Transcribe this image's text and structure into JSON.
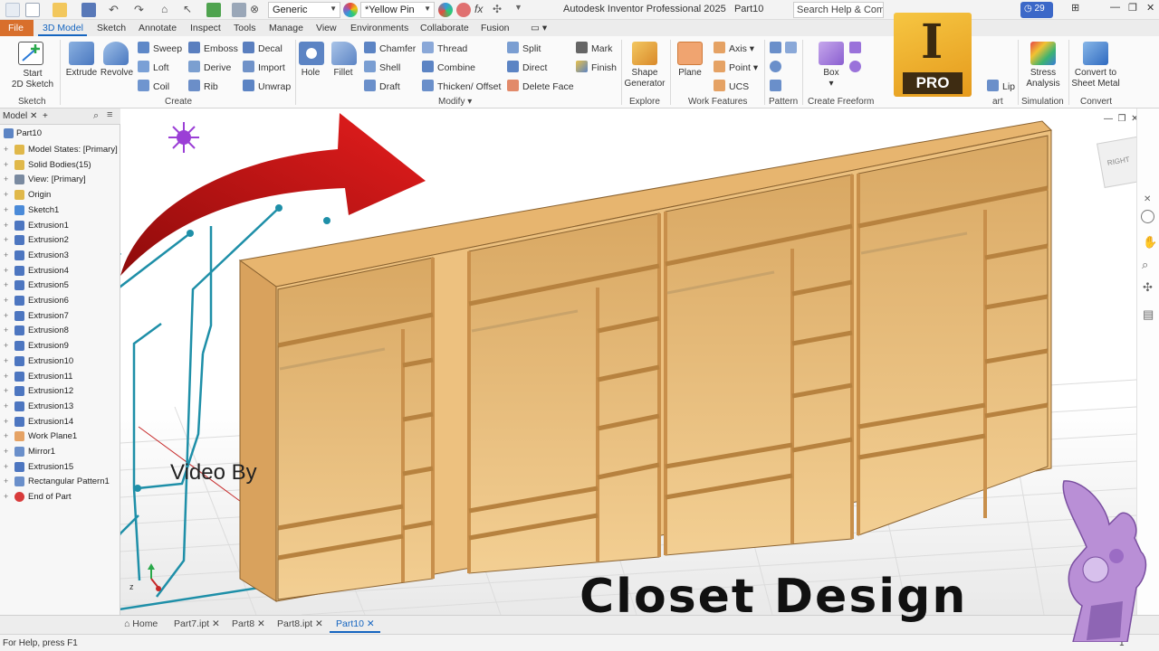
{
  "titlebar": {
    "style_combo": "Generic",
    "color_combo": "*Yellow Pin",
    "title": "Autodesk Inventor Professional 2025",
    "doc_name": "Part10",
    "search_placeholder": "Search Help & Comm",
    "clock_count": "29"
  },
  "tabs": [
    "File",
    "3D Model",
    "Sketch",
    "Annotate",
    "Inspect",
    "Tools",
    "Manage",
    "View",
    "Environments",
    "Collaborate",
    "Fusion"
  ],
  "ribbon": {
    "sketch": {
      "start_label": "Start",
      "start_label2": "2D Sketch",
      "panel": "Sketch"
    },
    "create": {
      "extrude": "Extrude",
      "revolve": "Revolve",
      "sweep": "Sweep",
      "loft": "Loft",
      "coil": "Coil",
      "emboss": "Emboss",
      "derive": "Derive",
      "rib": "Rib",
      "decal": "Decal",
      "import": "Import",
      "unwrap": "Unwrap",
      "panel": "Create"
    },
    "modify": {
      "hole": "Hole",
      "fillet": "Fillet",
      "chamfer": "Chamfer",
      "shell": "Shell",
      "draft": "Draft",
      "thread": "Thread",
      "combine": "Combine",
      "thicken": "Thicken/ Offset",
      "split": "Split",
      "direct": "Direct",
      "delete_face": "Delete Face",
      "mark": "Mark",
      "finish": "Finish",
      "panel": "Modify"
    },
    "explore": {
      "shape_generator": "Shape",
      "shape_generator2": "Generator",
      "panel": "Explore"
    },
    "work_features": {
      "plane": "Plane",
      "axis": "Axis",
      "point": "Point",
      "ucs": "UCS",
      "panel": "Work Features"
    },
    "pattern": {
      "panel": "Pattern"
    },
    "freeform": {
      "box": "Box",
      "panel": "Create Freeform"
    },
    "surface": {
      "lip": "Lip",
      "panel": "art"
    },
    "simulation": {
      "stress": "Stress",
      "stress2": "Analysis",
      "panel": "Simulation"
    },
    "convert": {
      "sheet_metal": "Convert to",
      "sheet_metal2": "Sheet Metal",
      "panel": "Convert"
    }
  },
  "browser": {
    "tab_label": "Model",
    "root": "Part10",
    "items": [
      "Model States: [Primary]",
      "Solid Bodies(15)",
      "View: [Primary]",
      "Origin",
      "Sketch1",
      "Extrusion1",
      "Extrusion2",
      "Extrusion3",
      "Extrusion4",
      "Extrusion5",
      "Extrusion6",
      "Extrusion7",
      "Extrusion8",
      "Extrusion9",
      "Extrusion10",
      "Extrusion11",
      "Extrusion12",
      "Extrusion13",
      "Extrusion14",
      "Work Plane1",
      "Mirror1",
      "Extrusion15",
      "Rectangular Pattern1",
      "End of Part"
    ]
  },
  "viewcube_label": "RIGHT",
  "overlay": {
    "logo_letter": "I",
    "logo_badge": "PRO",
    "video_by": "Video By",
    "title": "Closet Design"
  },
  "doc_tabs": [
    "Home",
    "Part7.ipt",
    "Part8",
    "Part8.ipt",
    "Part10"
  ],
  "status": {
    "help": "For Help, press F1",
    "count": "1"
  },
  "colors": {
    "accent": "#1565c0",
    "file_tab": "#d86f2c",
    "wood": "#e8b872",
    "arrow": "#d11414",
    "circuit": "#1e8fa8"
  }
}
